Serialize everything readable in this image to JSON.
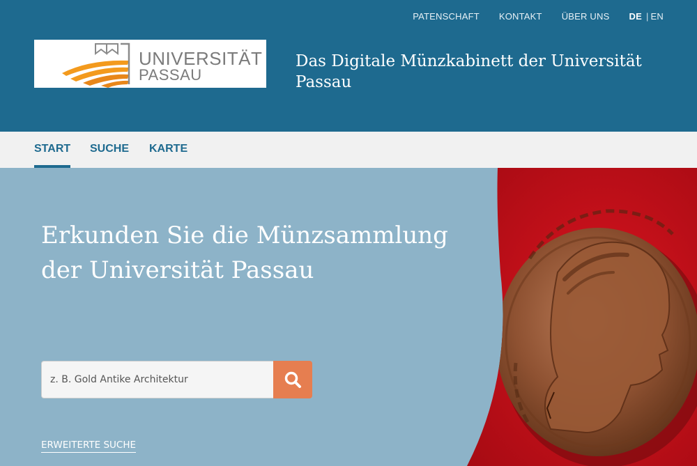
{
  "header": {
    "top_links": [
      "PATENSCHAFT",
      "KONTAKT",
      "ÜBER UNS"
    ],
    "language": {
      "active": "DE",
      "separator": "|",
      "other": "EN"
    },
    "logo": {
      "line1": "UNIVERSITÄT",
      "line2": "PASSAU"
    },
    "site_title": "Das Digitale Münzkabinett der Universität Passau"
  },
  "nav": {
    "items": [
      "START",
      "SUCHE",
      "KARTE"
    ],
    "active": "START"
  },
  "hero": {
    "heading": "Erkunden Sie die Münzsammlung der Universität Passau",
    "search_placeholder": "z. B. Gold Antike Architektur",
    "advanced_search": "ERWEITERTE SUCHE",
    "image": "roman-coin-on-red-background"
  },
  "colors": {
    "header_bg": "#1e6a8f",
    "nav_bg": "#f1f1f1",
    "hero_bg": "#8db3c8",
    "search_button": "#e67e50",
    "coin_backdrop": "#c8101a"
  }
}
